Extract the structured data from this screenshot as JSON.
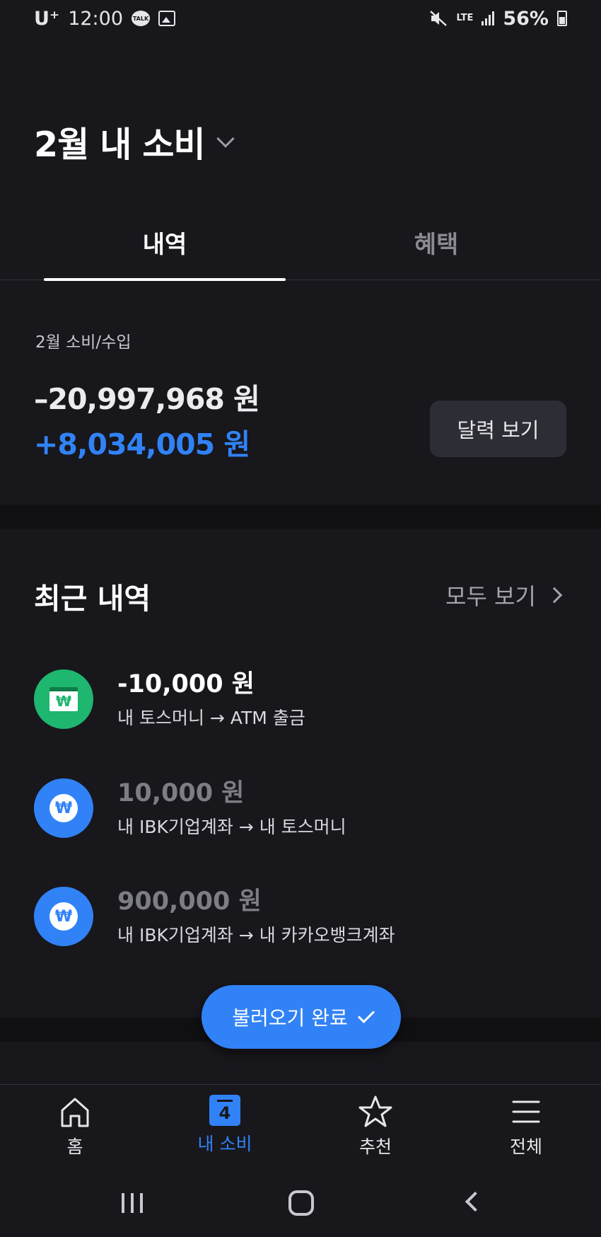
{
  "status_bar": {
    "carrier": "U⁺",
    "time": "12:00",
    "talk_badge": "TALK",
    "network": "LTE",
    "battery": "56%"
  },
  "header": {
    "title": "2월 내 소비"
  },
  "tabs": [
    {
      "label": "내역",
      "active": true
    },
    {
      "label": "혜택",
      "active": false
    }
  ],
  "summary": {
    "label": "2월 소비/수입",
    "expense": "–20,997,968 원",
    "income": "+8,034,005 원",
    "calendar_button": "달력 보기"
  },
  "recent": {
    "title": "최근 내역",
    "see_all": "모두 보기",
    "items": [
      {
        "amount": "-10,000 원",
        "desc": "내 토스머니 → ATM 출금",
        "icon": "atm-icon",
        "icon_color": "#1fb670"
      },
      {
        "amount": "10,000 원",
        "desc": "내 IBK기업계좌 → 내 토스머니",
        "icon": "won-icon",
        "icon_color": "#3182f6"
      },
      {
        "amount": "900,000 원",
        "desc": "내 IBK기업계좌 → 내 카카오뱅크계좌",
        "icon": "won-icon",
        "icon_color": "#3182f6"
      }
    ],
    "won_symbol": "₩"
  },
  "toast": {
    "label": "불러오기 완료"
  },
  "bottom_nav": {
    "items": [
      {
        "label": "홈",
        "icon": "home-icon",
        "active": false
      },
      {
        "label": "내 소비",
        "icon": "calendar-icon",
        "active": true,
        "badge": "4"
      },
      {
        "label": "추천",
        "icon": "star-icon",
        "active": false
      },
      {
        "label": "전체",
        "icon": "menu-icon",
        "active": false
      }
    ]
  },
  "colors": {
    "background": "#17171c",
    "accent": "#3182f6",
    "green": "#1fb670"
  }
}
